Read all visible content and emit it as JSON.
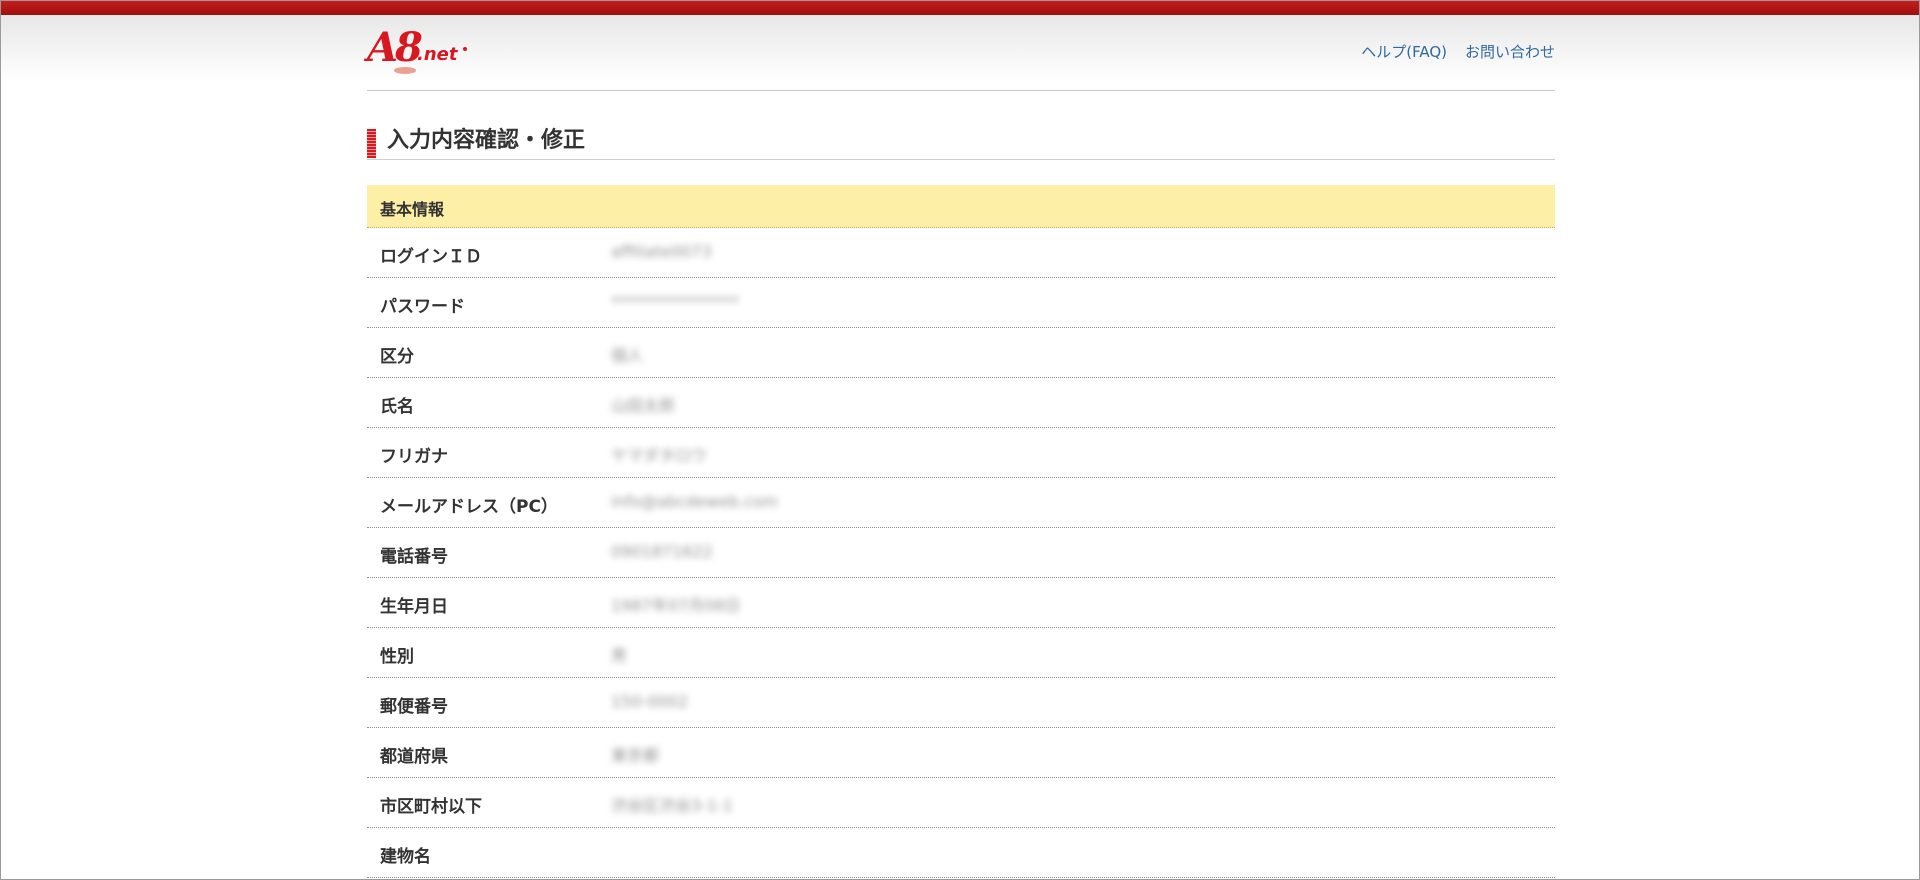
{
  "header": {
    "logo_text": "A8",
    "logo_suffix": ".net",
    "links": [
      {
        "label": "ヘルプ(FAQ)"
      },
      {
        "label": "お問い合わせ"
      }
    ]
  },
  "page": {
    "title": "入力内容確認・修正"
  },
  "section": {
    "title": "基本情報",
    "rows": [
      {
        "label": "ログインＩＤ",
        "value": "affiliate0073"
      },
      {
        "label": "パスワード",
        "value": "****************"
      },
      {
        "label": "区分",
        "value": "個人"
      },
      {
        "label": "氏名",
        "value": "山田太郎"
      },
      {
        "label": "フリガナ",
        "value": "ヤマダタロウ"
      },
      {
        "label": "メールアドレス（PC）",
        "value": "info@abcdeweb.com"
      },
      {
        "label": "電話番号",
        "value": "0901871622"
      },
      {
        "label": "生年月日",
        "value": "1987年07月08日"
      },
      {
        "label": "性別",
        "value": "男"
      },
      {
        "label": "郵便番号",
        "value": "150-0002"
      },
      {
        "label": "都道府県",
        "value": "東京都"
      },
      {
        "label": "市区町村以下",
        "value": "渋谷区渋谷3-1-1"
      },
      {
        "label": "建物名",
        "value": ""
      }
    ]
  },
  "colors": {
    "brand_red": "#d8171e",
    "section_yellow": "#fdf0a6",
    "link_blue": "#2f6a9e"
  }
}
